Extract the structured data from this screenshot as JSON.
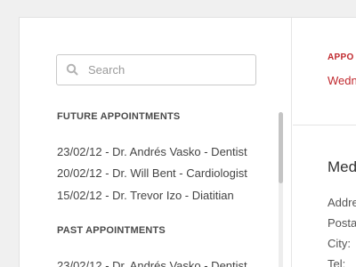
{
  "search": {
    "placeholder": "Search",
    "icon": "search-icon"
  },
  "sidebar": {
    "future_title": "FUTURE APPOINTMENTS",
    "future": [
      "23/02/12 - Dr. Andrés Vasko - Dentist",
      "20/02/12 - Dr. Will Bent - Cardiologist",
      "15/02/12 - Dr. Trevor Izo - Diatitian"
    ],
    "past_title": "PAST APPOINTMENTS",
    "past": [
      "23/02/12 - Dr. Andrés Vasko - Dentist"
    ]
  },
  "detail": {
    "label": "APPO",
    "date": "Wedn",
    "heading": "Med",
    "fields": [
      "Addre",
      "Posta",
      "City:",
      "Tel:"
    ]
  },
  "colors": {
    "accent": "#c0282d",
    "background": "#f0f0f0",
    "panel": "#ffffff"
  }
}
